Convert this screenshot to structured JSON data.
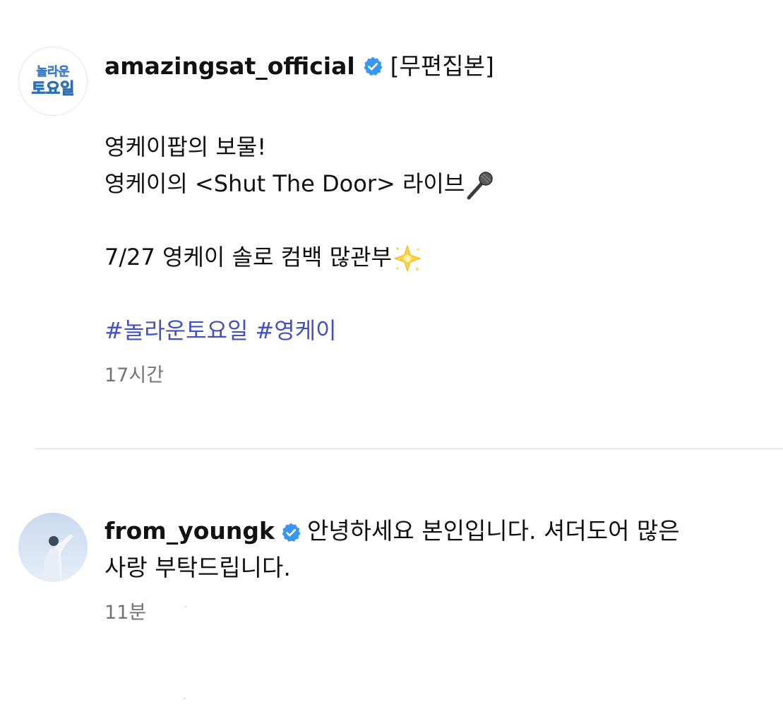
{
  "post": {
    "username": "amazingsat_official",
    "title_suffix": "[무편집본]",
    "logo_text_top": "놀라운",
    "logo_text_bottom": "토요일",
    "line1": "영케이팝의 보물!",
    "line2": "영케이의 <Shut The Door> 라이브",
    "line3": "7/27 영케이 솔로 컴백 많관부",
    "hashtags": [
      "#놀라운토요일",
      "#영케이"
    ],
    "time": "17시간"
  },
  "reply": {
    "username": "from_youngk",
    "text_line1": "안녕하세요 본인입니다. 셔더도어 많은",
    "text_line2": "사랑 부탁드립니다.",
    "time": "11분"
  },
  "icons": {
    "verified": "verified-badge-icon",
    "microphone": "microphone-emoji",
    "sparkle": "sparkle-star-emoji"
  },
  "colors": {
    "verified_blue": "#3897f0",
    "hashtag_blue": "#4150c2",
    "timestamp_gray": "#737373",
    "divider": "#dbdbdb"
  }
}
